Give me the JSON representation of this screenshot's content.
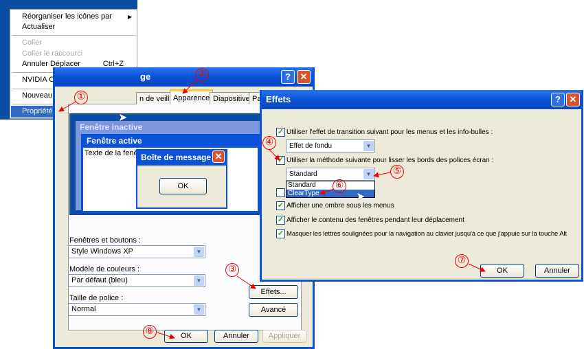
{
  "context_menu": {
    "items": [
      {
        "label": "Réorganiser les icônes par",
        "submenu": true
      },
      {
        "label": "Actualiser"
      },
      {
        "label": "Coller",
        "disabled": true
      },
      {
        "label": "Coller le raccourci",
        "disabled": true
      },
      {
        "label": "Annuler Déplacer",
        "shortcut": "Ctrl+Z"
      },
      {
        "label": "NVIDIA Control Panel"
      },
      {
        "label": "Nouveau",
        "submenu": true
      },
      {
        "label": "Propriétés",
        "selected": true
      }
    ]
  },
  "display_dialog": {
    "title_fragment": "ge",
    "tabs": [
      "n de veille",
      "Apparence",
      "Diapositive",
      "Pa"
    ],
    "active_tab": "Apparence",
    "preview": {
      "inactive_title": "Fenêtre inactive",
      "active_title": "Fenêtre active",
      "window_text": "Texte de la fenêtre",
      "msgbox_title": "Boîte de message",
      "msgbox_ok": "OK"
    },
    "fields": [
      {
        "label": "Fenêtres et boutons :",
        "value": "Style Windows XP"
      },
      {
        "label": "Modèle de couleurs :",
        "value": "Par défaut (bleu)"
      },
      {
        "label": "Taille de police :",
        "value": "Normal"
      }
    ],
    "effects_button": "Effets...",
    "advanced_button": "Avancé",
    "ok": "OK",
    "cancel": "Annuler",
    "apply": "Appliquer"
  },
  "effects_dialog": {
    "title": "Effets",
    "transition": {
      "label": "Utiliser l'effet de transition suivant pour les menus et les info-bulles :",
      "checked": true,
      "value": "Effet de fondu"
    },
    "smoothing": {
      "label": "Utiliser la méthode suivante pour lisser les bords des polices écran :",
      "checked": true,
      "value": "Standard",
      "options": [
        "Standard",
        "ClearType"
      ],
      "highlighted": "ClearType"
    },
    "checkboxes": [
      {
        "label": "",
        "checked": false
      },
      {
        "label": "Afficher une ombre sous les menus",
        "checked": true
      },
      {
        "label": "Afficher le contenu des fenêtres pendant leur déplacement",
        "checked": true
      },
      {
        "label": "Masquer les lettres soulignées pour la navigation au clavier jusqu'à ce que j'appuie sur la touche Alt",
        "checked": true
      }
    ],
    "ok": "OK",
    "cancel": "Annuler"
  },
  "annotations": [
    "①",
    "②",
    "③",
    "④",
    "⑤",
    "⑥",
    "⑦",
    "⑧"
  ],
  "colors": {
    "xp_blue": "#0a52d6",
    "annotation_red": "#e00000",
    "selection": "#316ac5"
  }
}
